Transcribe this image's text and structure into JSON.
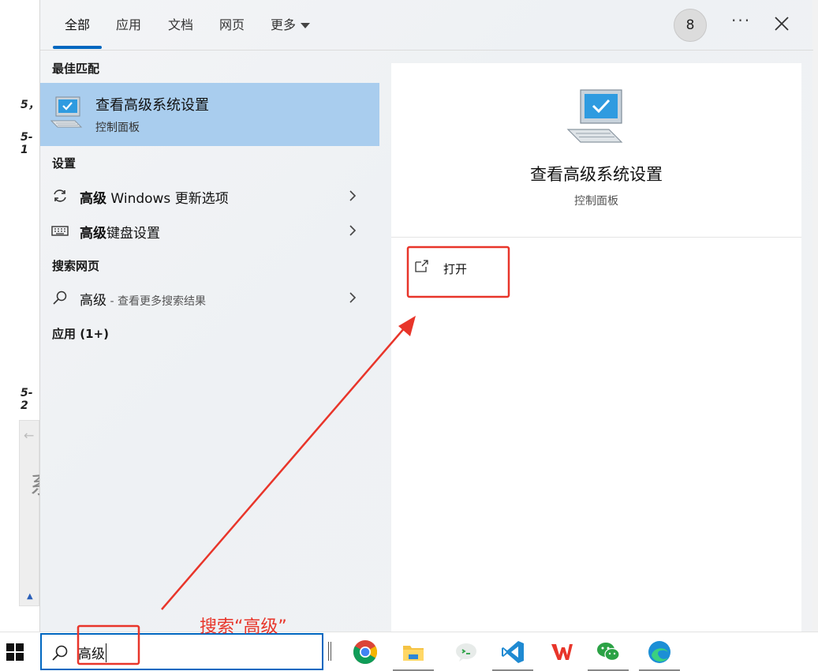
{
  "background": {
    "labels": [
      "5，",
      "5-1",
      "5-2"
    ],
    "big_glyph": "系"
  },
  "tabs": [
    {
      "label": "全部",
      "active": true
    },
    {
      "label": "应用",
      "active": false
    },
    {
      "label": "文档",
      "active": false
    },
    {
      "label": "网页",
      "active": false
    },
    {
      "label": "更多",
      "active": false,
      "dropdown": true
    }
  ],
  "header": {
    "badge": "8",
    "more_icon": "more-dots-icon",
    "close_icon": "close-icon"
  },
  "best_match": {
    "header": "最佳匹配",
    "title": "查看高级系统设置",
    "subtitle": "控制面板",
    "icon": "computer-settings-icon"
  },
  "settings": {
    "header": "设置",
    "items": [
      {
        "bold": "高级",
        "rest": " Windows 更新选项",
        "icon": "refresh-icon"
      },
      {
        "bold": "高级",
        "rest": "键盘设置",
        "icon": "keyboard-icon"
      }
    ]
  },
  "web": {
    "header": "搜索网页",
    "item": {
      "text": "高级",
      "sub": " - 查看更多搜索结果",
      "icon": "search-icon"
    }
  },
  "apps": {
    "header": "应用 (1+)"
  },
  "details": {
    "title": "查看高级系统设置",
    "subtitle": "控制面板",
    "open_label": "打开",
    "icon": "computer-settings-icon"
  },
  "taskbar": {
    "search_value": "高级",
    "apps": [
      {
        "name": "chrome",
        "icon": "chrome-icon"
      },
      {
        "name": "file-explorer",
        "icon": "folder-icon"
      },
      {
        "name": "wechat-dev-tools",
        "icon": "devtools-icon"
      },
      {
        "name": "vscode",
        "icon": "vscode-icon"
      },
      {
        "name": "wps",
        "icon": "wps-icon"
      },
      {
        "name": "wechat",
        "icon": "wechat-icon"
      },
      {
        "name": "edge",
        "icon": "edge-icon"
      }
    ]
  },
  "annotation": {
    "text": "搜索“高级”",
    "color": "#e8352a"
  },
  "colors": {
    "accent": "#0067c0",
    "selection": "#a9cdee"
  }
}
